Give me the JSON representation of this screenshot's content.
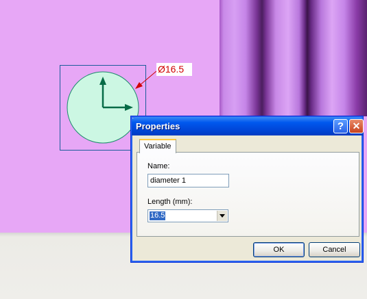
{
  "viewport": {
    "background_color": "#e7a7f6",
    "circle_fill": "#ccf7e3",
    "axis_color": "#066b46",
    "dimension_color": "#d00000",
    "dimension_label": "Ø16.5"
  },
  "dialog": {
    "title": "Properties",
    "help_glyph": "?",
    "close_glyph": "✕",
    "tab_label": "Variable",
    "name_label": "Name:",
    "name_value": "diameter 1",
    "length_label": "Length (mm):",
    "length_value": "16.5",
    "ok_label": "OK",
    "cancel_label": "Cancel"
  },
  "icons": [
    "help-icon",
    "close-icon",
    "dropdown-arrow-icon"
  ]
}
